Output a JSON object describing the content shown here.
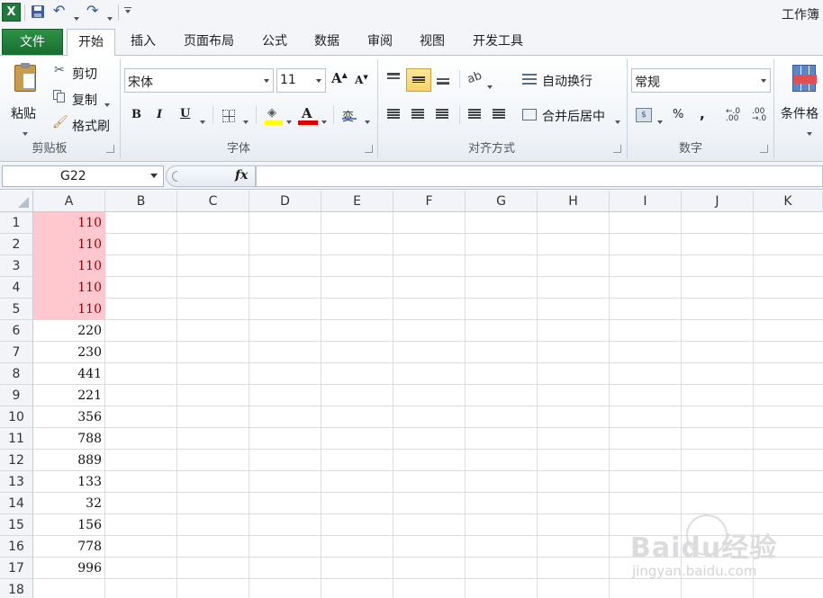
{
  "titlebar": {
    "title": "工作簿"
  },
  "tabs": {
    "file": "文件",
    "home": "开始",
    "insert": "插入",
    "page_layout": "页面布局",
    "formulas": "公式",
    "data": "数据",
    "review": "审阅",
    "view": "视图",
    "developer": "开发工具"
  },
  "clipboard": {
    "paste": "粘贴",
    "cut": "剪切",
    "copy": "复制",
    "format_painter": "格式刷",
    "group": "剪贴板"
  },
  "font": {
    "name": "宋体",
    "size": "11",
    "bold": "B",
    "italic": "I",
    "underline": "U",
    "color_letter": "A",
    "group": "字体"
  },
  "alignment": {
    "wrap_text": "自动换行",
    "merge_center": "合并后居中",
    "group": "对齐方式"
  },
  "number": {
    "format": "常规",
    "percent": "%",
    "comma": ",",
    "group": "数字"
  },
  "styles": {
    "conditional": "条件格"
  },
  "formula_bar": {
    "name_box": "G22",
    "fx": "fx",
    "formula": ""
  },
  "columns": [
    "A",
    "B",
    "C",
    "D",
    "E",
    "F",
    "G",
    "H",
    "I",
    "J",
    "K"
  ],
  "rows": [
    "1",
    "2",
    "3",
    "4",
    "5",
    "6",
    "7",
    "8",
    "9",
    "10",
    "11",
    "12",
    "13",
    "14",
    "15",
    "16",
    "17",
    "18"
  ],
  "column_a_values": [
    "110",
    "110",
    "110",
    "110",
    "110",
    "220",
    "230",
    "441",
    "221",
    "356",
    "788",
    "889",
    "133",
    "32",
    "156",
    "778",
    "996",
    ""
  ],
  "highlighted_rows": [
    1,
    2,
    3,
    4,
    5
  ],
  "colors": {
    "highlight_fill": "#ffc7ce",
    "highlight_text": "#9c0006",
    "file_tab": "#1e7b35",
    "accent": "#f7d46a"
  },
  "watermark": {
    "logo": "Baidu经验",
    "url": "jingyan.baidu.com"
  }
}
